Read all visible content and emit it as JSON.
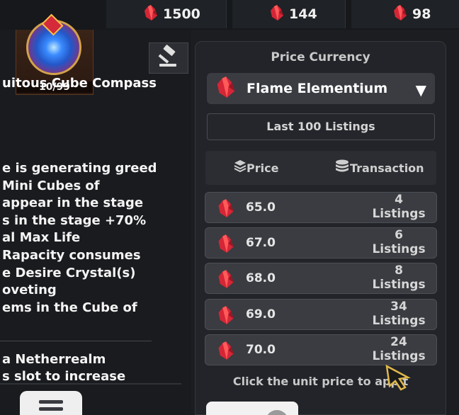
{
  "currencies": [
    {
      "icon": "flame-elementium-icon",
      "amount": "1500"
    },
    {
      "icon": "flame-elementium-icon",
      "amount": "144"
    },
    {
      "icon": "flame-elementium-icon",
      "amount": "98"
    }
  ],
  "item": {
    "count": "10/99",
    "name": "uitous Cube Compass",
    "description_lines": [
      "e is generating greed",
      " Mini Cubes of",
      " appear in the stage",
      "s in the stage +70%",
      "al Max Life",
      "Rapacity consumes",
      "e Desire Crystal(s)",
      "oveting",
      "ems in the Cube of"
    ],
    "description2_lines": [
      " a Netherrealm",
      "s slot to increase"
    ]
  },
  "market": {
    "price_currency_label": "Price Currency",
    "selected_currency": "Flame Elementium",
    "dropdown_glyph": "▼",
    "last_listings_label": "Last 100 Listings",
    "sort_price_label": "Price",
    "sort_transaction_label": "Transaction",
    "listings": [
      {
        "price": "65.0",
        "count": "4",
        "unit": "Listings"
      },
      {
        "price": "67.0",
        "count": "6",
        "unit": "Listings"
      },
      {
        "price": "68.0",
        "count": "8",
        "unit": "Listings"
      },
      {
        "price": "69.0",
        "count": "34",
        "unit": "Listings"
      },
      {
        "price": "70.0",
        "count": "24",
        "unit": "Listings"
      }
    ],
    "hint": "Click the unit price to app    t"
  },
  "colors": {
    "crystal": "#d42636",
    "background": "#1c1d21",
    "panel": "#222429",
    "row": "#3a3c41"
  }
}
